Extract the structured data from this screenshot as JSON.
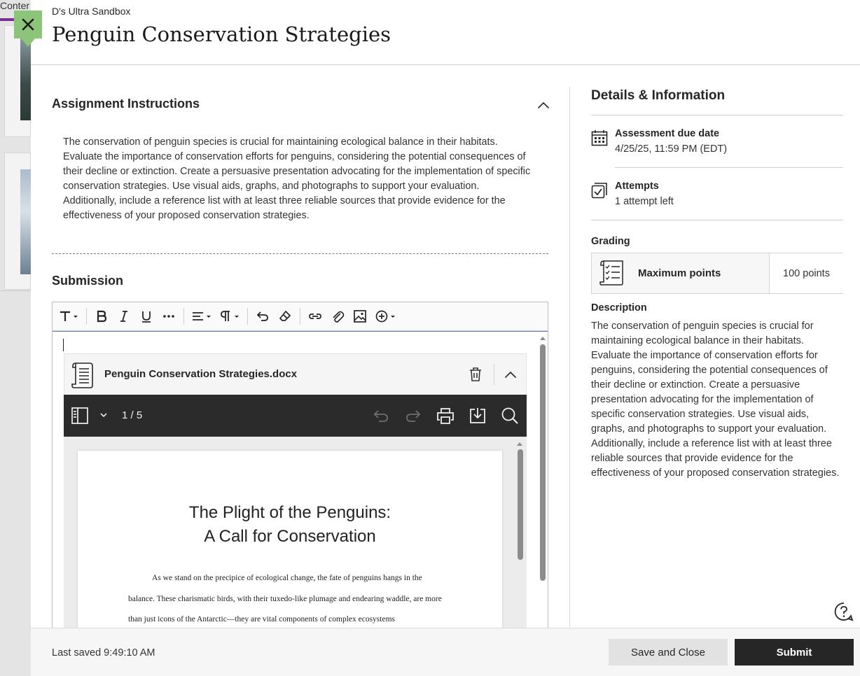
{
  "background": {
    "content_label": "Conter"
  },
  "header": {
    "course_name": "D's Ultra Sandbox",
    "title": "Penguin Conservation Strategies",
    "close_icon": "close-icon"
  },
  "instructions": {
    "heading": "Assignment Instructions",
    "text": "The conservation of penguin species is crucial for maintaining ecological balance in their habitats. Evaluate the importance of conservation efforts for penguins, considering the potential consequences of their decline or extinction. Create a persuasive presentation advocating for the implementation of specific conservation strategies. Use visual aids, graphs, and photographs to support your evaluation. Additionally, include a reference list with at least three reliable sources that provide evidence for the effectiveness of your proposed conservation strategies."
  },
  "submission": {
    "heading": "Submission",
    "toolbar": [
      "text-style-icon",
      "bold-icon",
      "italic-icon",
      "underline-icon",
      "more-icon",
      "align-icon",
      "paragraph-icon",
      "undo-icon",
      "clear-format-icon",
      "link-icon",
      "attach-icon",
      "image-icon",
      "insert-icon"
    ],
    "attachment": {
      "file_name": "Penguin Conservation Strategies.docx",
      "page_indicator": "1 / 5",
      "document_title_line1": "The Plight of the Penguins:",
      "document_title_line2": "A Call for Conservation",
      "document_paragraph": "As we stand on the precipice of ecological change, the fate of penguins hangs in the balance. These charismatic birds, with their tuxedo-like plumage and endearing waddle, are more than just icons of the Antarctic—they are vital components of complex ecosystems"
    }
  },
  "details": {
    "heading": "Details & Information",
    "due_date_label": "Assessment due date",
    "due_date_value": "4/25/25, 11:59 PM (EDT)",
    "attempts_label": "Attempts",
    "attempts_value": "1 attempt left",
    "grading_label": "Grading",
    "max_points_label": "Maximum points",
    "max_points_value": "100 points",
    "description_label": "Description",
    "description_text": "The conservation of penguin species is crucial for maintaining ecological balance in their habitats. Evaluate the importance of conservation efforts for penguins, considering the potential consequences of their decline or extinction. Create a persuasive presentation advocating for the implementation of specific conservation strategies. Use visual aids, graphs, and photographs to support your evaluation. Additionally, include a reference list with at least three reliable sources that provide evidence for the effectiveness of your proposed conservation strategies."
  },
  "footer": {
    "last_saved": "Last saved 9:49:10 AM",
    "save_close_label": "Save and Close",
    "submit_label": "Submit"
  },
  "colors": {
    "close_button": "#8cc47a",
    "primary_button": "#262626",
    "viewer_toolbar": "#2b2b2b",
    "background_accent": "#7a2f8f"
  }
}
